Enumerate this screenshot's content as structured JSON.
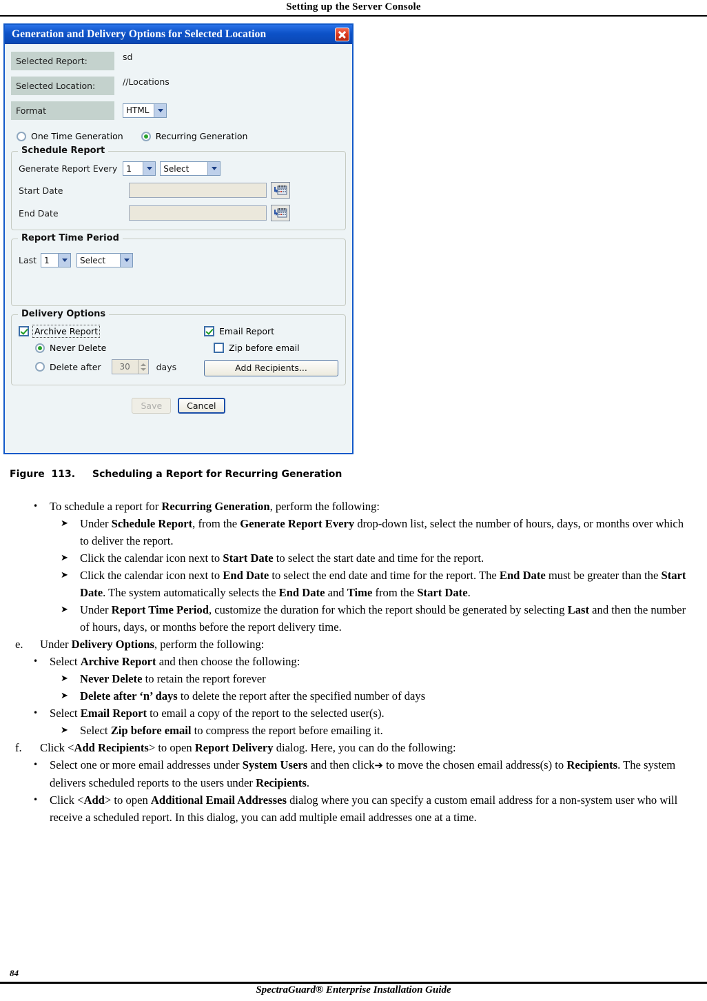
{
  "page": {
    "header_title": "Setting up the Server Console",
    "page_number": "84",
    "footer_title": "SpectraGuard® Enterprise Installation Guide"
  },
  "dialog": {
    "title": "Generation and Delivery Options for Selected Location",
    "close_icon": "close-icon",
    "fields": [
      {
        "label": "Selected Report:",
        "value": "sd"
      },
      {
        "label": "Selected Location:",
        "value": "//Locations"
      }
    ],
    "format": {
      "label": "Format",
      "selected": "HTML",
      "chevron_icon": "chevron-down-icon"
    },
    "generation_mode": {
      "one_time": {
        "label": "One Time Generation",
        "selected": false
      },
      "recurring": {
        "label": "Recurring Generation",
        "selected": true
      }
    },
    "schedule_report": {
      "legend": "Schedule Report",
      "generate_every_label": "Generate Report Every",
      "interval_number": "1",
      "interval_unit": "Select",
      "start_date_label": "Start Date",
      "start_date_value": "",
      "end_date_label": "End Date",
      "end_date_value": "",
      "calendar_icon": "calendar-icon"
    },
    "report_time_period": {
      "legend": "Report Time Period",
      "last_label": "Last",
      "last_number": "1",
      "last_unit": "Select"
    },
    "delivery_options": {
      "legend": "Delivery Options",
      "archive_report": {
        "label": "Archive Report",
        "checked": true
      },
      "never_delete": {
        "label": "Never Delete",
        "selected": true
      },
      "delete_after": {
        "label": "Delete after",
        "value": "30",
        "unit": "days",
        "selected": false
      },
      "email_report": {
        "label": "Email Report",
        "checked": true
      },
      "zip_before_email": {
        "label": "Zip before email",
        "checked": false
      },
      "add_recipients_button": "Add Recipients..."
    },
    "footer": {
      "save_label": "Save",
      "save_disabled": true,
      "cancel_label": "Cancel"
    },
    "colors": {
      "titlebar": "#0d52c8",
      "dialog_bg": "#eef4f6",
      "label_box": "#c4d2cd",
      "input_bg": "#ebe8dc",
      "close_red": "#d8341b",
      "check_green": "#1e9b25"
    }
  },
  "figure": {
    "label": "Figure  113.",
    "caption": "Scheduling a Report for Recurring Generation"
  },
  "body": {
    "items": [
      {
        "level": "b",
        "mark": "•",
        "parts": [
          {
            "t": "To schedule a report for "
          },
          {
            "t": "Recurring Generation",
            "b": true
          },
          {
            "t": ", perform the following:"
          }
        ]
      },
      {
        "level": "c",
        "mark": "➤",
        "parts": [
          {
            "t": "Under "
          },
          {
            "t": "Schedule Report",
            "b": true
          },
          {
            "t": ", from the "
          },
          {
            "t": "Generate Report Every",
            "b": true
          },
          {
            "t": " drop-down list, select the number of hours, days, or months over which to deliver the report."
          }
        ]
      },
      {
        "level": "c",
        "mark": "➤",
        "parts": [
          {
            "t": "Click the calendar icon next to "
          },
          {
            "t": "Start Date",
            "b": true
          },
          {
            "t": " to select the start date and time for the report."
          }
        ]
      },
      {
        "level": "c",
        "mark": "➤",
        "parts": [
          {
            "t": "Click the calendar icon next to "
          },
          {
            "t": "End Date",
            "b": true
          },
          {
            "t": " to select the end date and time for the report. The "
          },
          {
            "t": "End Date",
            "b": true
          },
          {
            "t": " must be greater than the "
          },
          {
            "t": "Start Date",
            "b": true
          },
          {
            "t": ". The system automatically selects the "
          },
          {
            "t": "End Date",
            "b": true
          },
          {
            "t": " and "
          },
          {
            "t": "Time",
            "b": true
          },
          {
            "t": " from the "
          },
          {
            "t": "Start Date",
            "b": true
          },
          {
            "t": "."
          }
        ]
      },
      {
        "level": "c",
        "mark": "➤",
        "parts": [
          {
            "t": "Under "
          },
          {
            "t": "Report Time Period",
            "b": true
          },
          {
            "t": ", customize the duration for which the report should be generated by selecting "
          },
          {
            "t": "Last",
            "b": true
          },
          {
            "t": " and then the number of hours, days, or months before the report delivery time."
          }
        ]
      },
      {
        "level": "a",
        "mark": "e.",
        "parts": [
          {
            "t": "Under "
          },
          {
            "t": "Delivery Options",
            "b": true
          },
          {
            "t": ", perform the following:"
          }
        ]
      },
      {
        "level": "b",
        "mark": "•",
        "parts": [
          {
            "t": "Select "
          },
          {
            "t": "Archive Report",
            "b": true
          },
          {
            "t": " and then choose the following:"
          }
        ]
      },
      {
        "level": "c",
        "mark": "➤",
        "parts": [
          {
            "t": "Never Delete",
            "b": true
          },
          {
            "t": " to retain the report forever"
          }
        ]
      },
      {
        "level": "c",
        "mark": "➤",
        "parts": [
          {
            "t": "Delete after ‘n’ days",
            "b": true
          },
          {
            "t": " to delete the report after the specified number of days"
          }
        ]
      },
      {
        "level": "b",
        "mark": "•",
        "parts": [
          {
            "t": "Select "
          },
          {
            "t": "Email Report",
            "b": true
          },
          {
            "t": " to email a copy of the report to the selected user(s)."
          }
        ]
      },
      {
        "level": "c",
        "mark": "➤",
        "parts": [
          {
            "t": "Select "
          },
          {
            "t": "Zip before email",
            "b": true
          },
          {
            "t": " to compress the report before emailing it."
          }
        ]
      },
      {
        "level": "a",
        "mark": "f.",
        "parts": [
          {
            "t": "Click <"
          },
          {
            "t": "Add Recipients",
            "b": true
          },
          {
            "t": "> to open "
          },
          {
            "t": "Report Delivery",
            "b": true
          },
          {
            "t": " dialog. Here, you can do the following:"
          }
        ]
      },
      {
        "level": "b",
        "mark": "•",
        "parts": [
          {
            "t": "Select one or more email addresses under "
          },
          {
            "t": "System Users",
            "b": true
          },
          {
            "t": " and then click"
          },
          {
            "t": "➔",
            "arrow": true
          },
          {
            "t": " to move the chosen email address(s) to "
          },
          {
            "t": "Recipients",
            "b": true
          },
          {
            "t": ". The system delivers scheduled reports to the users under "
          },
          {
            "t": "Recipients",
            "b": true
          },
          {
            "t": "."
          }
        ]
      },
      {
        "level": "b",
        "mark": "•",
        "parts": [
          {
            "t": "Click <"
          },
          {
            "t": "Add",
            "b": true
          },
          {
            "t": "> to open "
          },
          {
            "t": "Additional Email Addresses",
            "b": true
          },
          {
            "t": " dialog where you can specify a custom email address for a non-system user who will receive a scheduled report. In this dialog, you can add multiple email addresses one at a time."
          }
        ]
      }
    ]
  }
}
